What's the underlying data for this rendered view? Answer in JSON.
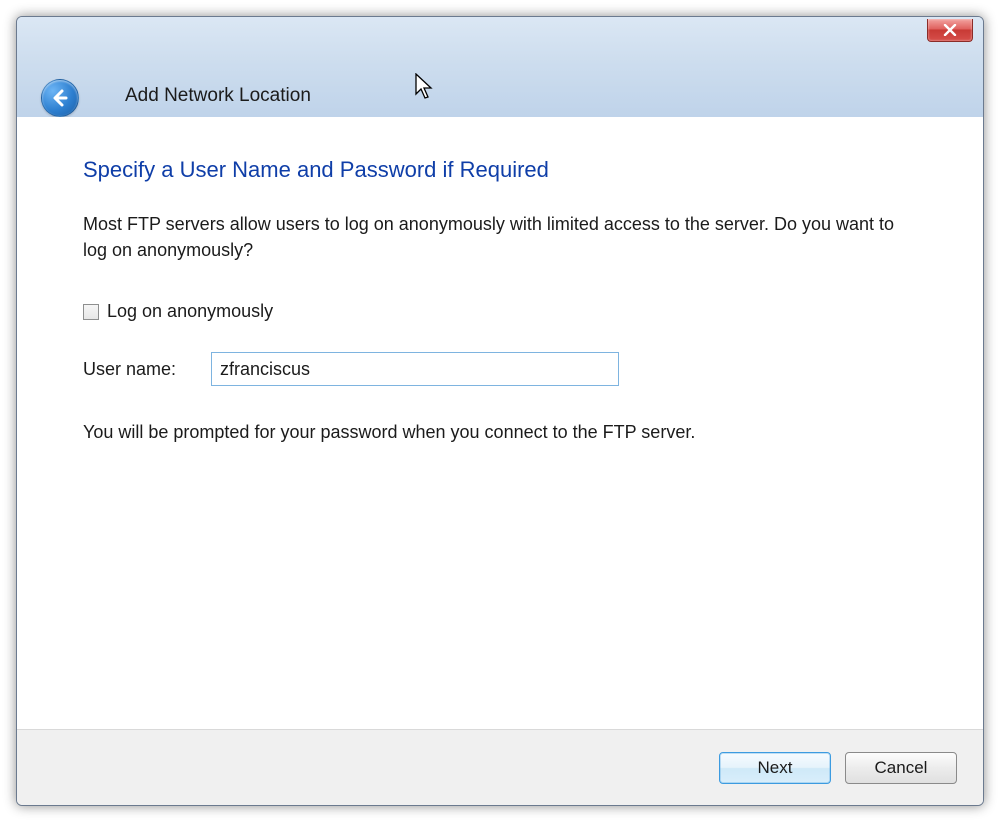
{
  "window": {
    "title": "Add Network Location"
  },
  "content": {
    "heading": "Specify a User Name and Password if Required",
    "description": "Most FTP servers allow users to log on anonymously with limited access to the server.  Do you want to log on anonymously?",
    "anon_checkbox_label": "Log on anonymously",
    "anon_checked": false,
    "username_label": "User name:",
    "username_value": "zfranciscus",
    "note": "You will be prompted for your password when you connect to the FTP server."
  },
  "buttons": {
    "next": "Next",
    "cancel": "Cancel"
  }
}
